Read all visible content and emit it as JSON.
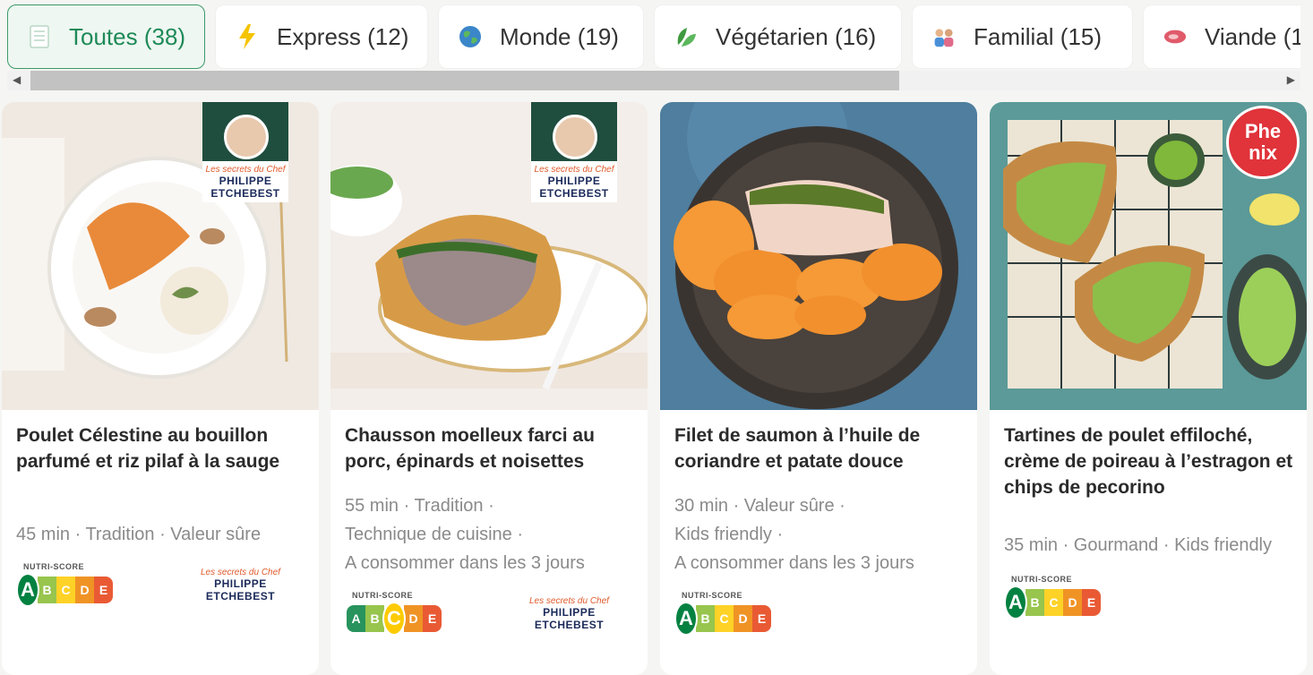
{
  "tabs": [
    {
      "label": "Toutes (38)",
      "icon": "list-icon",
      "active": true
    },
    {
      "label": "Express (12)",
      "icon": "lightning-icon"
    },
    {
      "label": "Monde (19)",
      "icon": "globe-icon"
    },
    {
      "label": "Végétarien (16)",
      "icon": "leaf-icon"
    },
    {
      "label": "Familial (15)",
      "icon": "family-icon"
    },
    {
      "label": "Viande (1",
      "icon": "meat-icon"
    }
  ],
  "recipes": [
    {
      "title": "Poulet Célestine au bouillon parfumé et riz pilaf à la sauge",
      "meta_lines": [
        "45 min · Tradition · Valeur sûre"
      ],
      "nutri_label": "NUTRI-SCORE",
      "nutri_score": "A",
      "badge": "chef",
      "brand": {
        "small": "Les secrets du Chef",
        "big1": "PHILIPPE",
        "big2": "ETCHEBEST"
      }
    },
    {
      "title": "Chausson moelleux farci au porc, épinards et noisettes",
      "meta_lines": [
        "55 min · Tradition ·",
        "Technique de cuisine ·",
        "A consommer dans les 3 jours"
      ],
      "nutri_label": "NUTRI-SCORE",
      "nutri_score": "C",
      "badge": "chef",
      "brand": {
        "small": "Les secrets du Chef",
        "big1": "PHILIPPE",
        "big2": "ETCHEBEST"
      }
    },
    {
      "title": "Filet de saumon à l’huile de coriandre et patate douce",
      "meta_lines": [
        "30 min · Valeur sûre ·",
        "Kids friendly ·",
        "A consommer dans les 3 jours"
      ],
      "nutri_label": "NUTRI-SCORE",
      "nutri_score": "A"
    },
    {
      "title": "Tartines de poulet effiloché, crème de poireau à l’estragon et chips de pecorino",
      "meta_lines": [
        "35 min · Gourmand · Kids friendly"
      ],
      "nutri_label": "NUTRI-SCORE",
      "nutri_score": "A",
      "badge": "phenix",
      "badge_text": [
        "Phe",
        "nix"
      ]
    }
  ],
  "colors": {
    "accent": "#1e8a58",
    "nutri_a": "#038141",
    "nutri_b": "#85bb2f",
    "nutri_c": "#fecb02",
    "nutri_d": "#ee8100",
    "nutri_e": "#e63e11"
  }
}
